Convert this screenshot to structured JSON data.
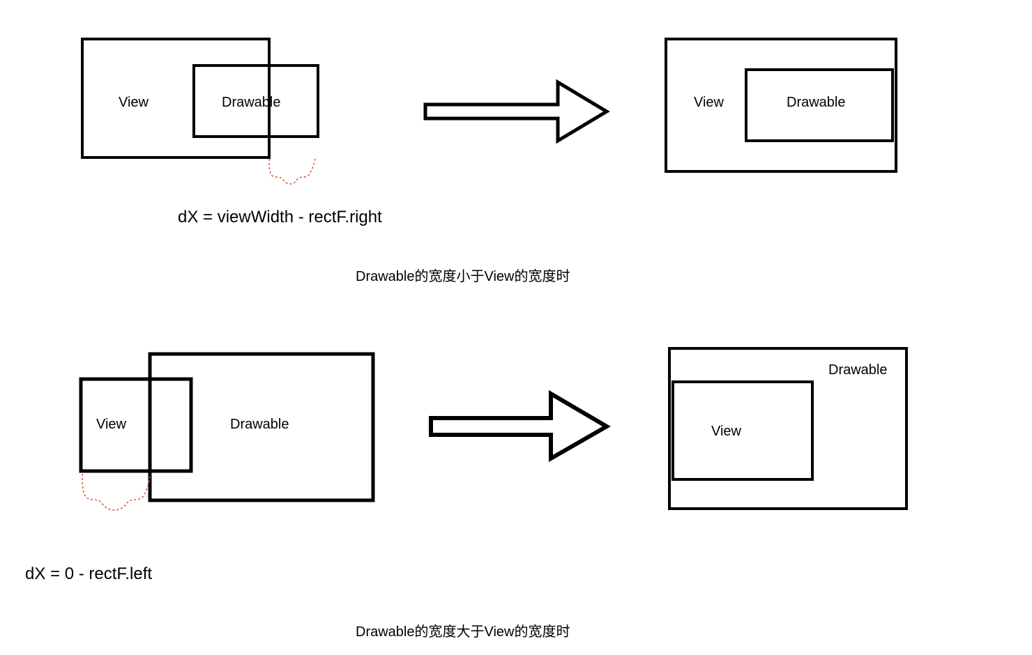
{
  "diagram1": {
    "left": {
      "view_label": "View",
      "drawable_label": "Drawable"
    },
    "right": {
      "view_label": "View",
      "drawable_label": "Drawable"
    },
    "formula": "dX = viewWidth - rectF.right",
    "caption": "Drawable的宽度小于View的宽度时"
  },
  "diagram2": {
    "left": {
      "view_label": "View",
      "drawable_label": "Drawable"
    },
    "right": {
      "view_label": "View",
      "drawable_label": "Drawable"
    },
    "formula": "dX = 0 - rectF.left",
    "caption": "Drawable的宽度大于View的宽度时"
  }
}
